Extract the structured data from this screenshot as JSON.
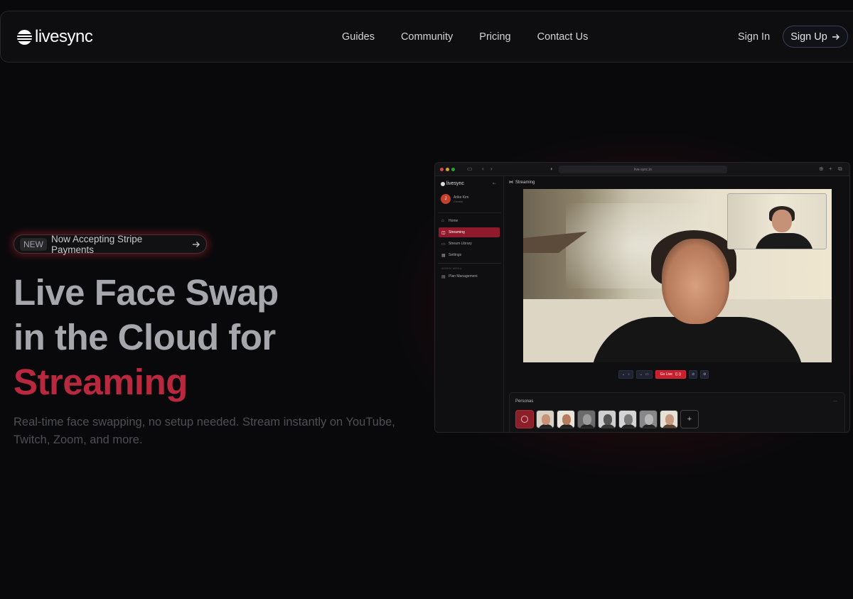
{
  "brand": {
    "name": "livesync"
  },
  "nav": {
    "links": [
      "Guides",
      "Community",
      "Pricing",
      "Contact Us"
    ],
    "sign_in": "Sign In",
    "sign_up": "Sign Up",
    "sign_up_icon": "arrow-right-icon"
  },
  "hero": {
    "badge_tag": "NEW",
    "badge_text": "Now Accepting Stripe Payments",
    "badge_icon": "arrow-right-icon",
    "headline_line1": "Live Face Swap",
    "headline_line2": "in the Cloud for",
    "headline_accent": "Streaming",
    "subtext": "Real-time face swapping, no setup needed. Stream instantly on YouTube, Twitch, Zoom, and more."
  },
  "preview": {
    "url": "live-sync.io",
    "sidebar": {
      "brand": "livesync",
      "user_initial": "J",
      "user_name": "Arike Kim",
      "user_role": "Creator",
      "items": [
        {
          "label": "Home",
          "icon": "home-icon",
          "active": false
        },
        {
          "label": "Streaming",
          "icon": "stream-icon",
          "active": true
        },
        {
          "label": "Stream Library",
          "icon": "folder-icon",
          "active": false
        },
        {
          "label": "Settings",
          "icon": "settings-icon",
          "active": false
        }
      ],
      "admin_heading": "ADMIN MENU",
      "admin_items": [
        {
          "label": "Plan Management",
          "icon": "card-icon"
        }
      ]
    },
    "page_title": "Streaming",
    "go_live_label": "Go Live",
    "personas_title": "Personas",
    "personas_menu": "...",
    "add_persona": "+"
  },
  "colors": {
    "background": "#09090b",
    "accent": "#b8283f",
    "active_item": "#8f1a2c",
    "go_live": "#c81e2e"
  }
}
